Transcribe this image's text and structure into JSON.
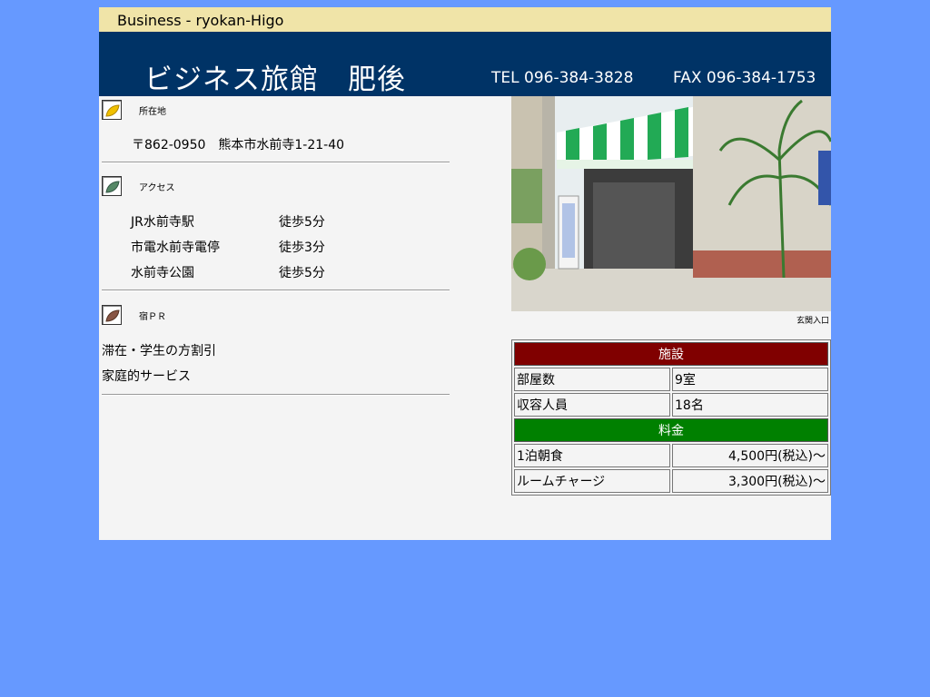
{
  "header": {
    "top_title": "Business - ryokan-Higo",
    "name": "ビジネス旅館　肥後",
    "tel": "TEL 096-384-3828",
    "fax": "FAX 096-384-1753"
  },
  "location": {
    "title": "所在地",
    "address": "〒862-0950　熊本市水前寺1-21-40",
    "icon": "leaf-yellow-icon",
    "icon_color": "#f0c000"
  },
  "access": {
    "title": "アクセス",
    "icon": "leaf-green-icon",
    "icon_color": "#558866",
    "rows": [
      {
        "place": "JR水前寺駅",
        "time": "徒歩5分"
      },
      {
        "place": "市電水前寺電停",
        "time": "徒歩3分"
      },
      {
        "place": "水前寺公園",
        "time": "徒歩5分"
      }
    ]
  },
  "pr": {
    "title": "宿ＰＲ",
    "icon": "leaf-brown-icon",
    "icon_color": "#885544",
    "lines": [
      "滞在・学生の方割引",
      "家庭的サービス"
    ]
  },
  "photo": {
    "caption": "玄関入口"
  },
  "facilities": {
    "header": "施設",
    "header_color": "#800000",
    "rows": [
      {
        "label": "部屋数",
        "value": "9室"
      },
      {
        "label": "収容人員",
        "value": "18名"
      }
    ]
  },
  "rates": {
    "header": "料金",
    "header_color": "#008000",
    "rows": [
      {
        "label": "1泊朝食",
        "value": "4,500円(税込)～"
      },
      {
        "label": "ルームチャージ",
        "value": "3,300円(税込)～"
      }
    ]
  },
  "colors": {
    "page_bg": "#6699ff",
    "banner_bg": "#003366",
    "topbar_bg": "#f0e4a8"
  }
}
